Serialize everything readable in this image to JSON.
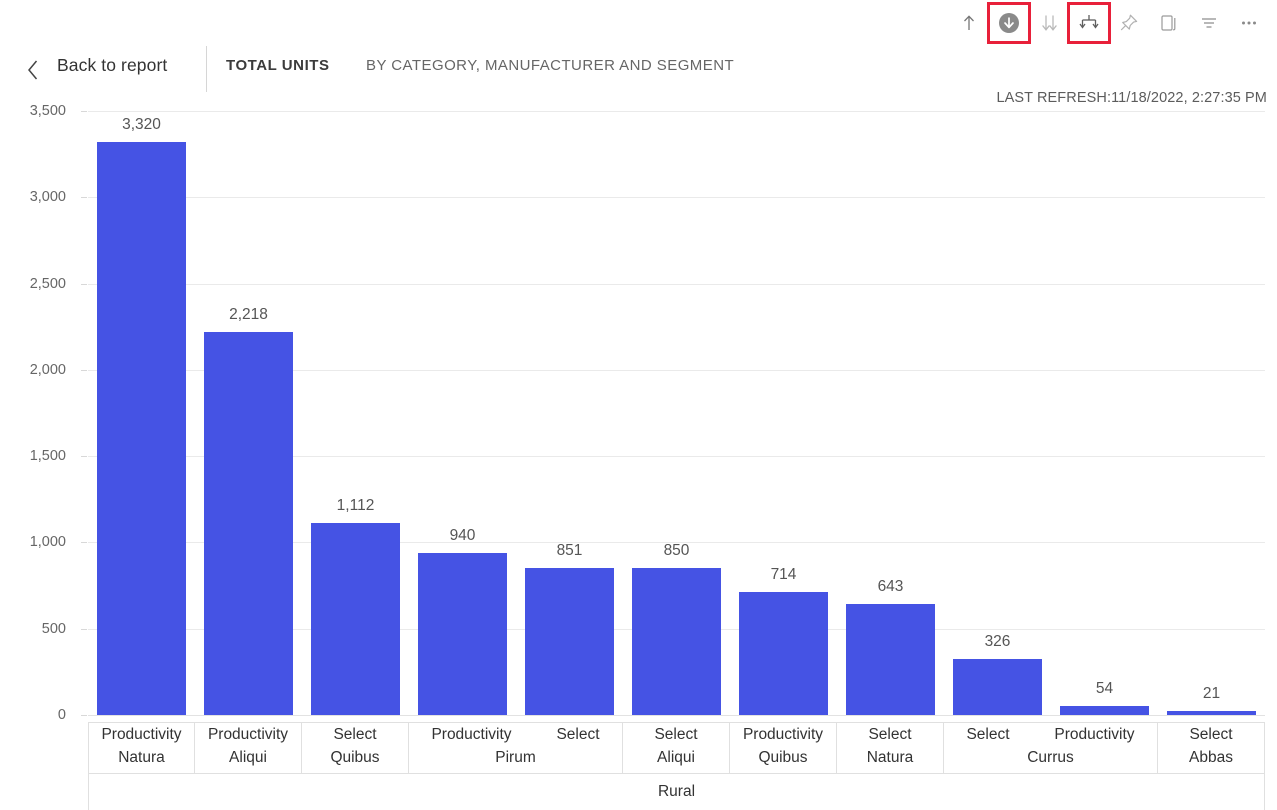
{
  "toolbar": {
    "icons": [
      {
        "name": "drill-up-icon",
        "label": "Drill up",
        "highlighted": false
      },
      {
        "name": "drill-down-toggle-icon",
        "label": "Click to turn on Drill Down",
        "highlighted": true
      },
      {
        "name": "expand-next-level-icon",
        "label": "Go to the next level in the hierarchy",
        "highlighted": false
      },
      {
        "name": "expand-all-down-icon",
        "label": "Expand all down one level in the hierarchy",
        "highlighted": true
      },
      {
        "name": "pin-visual-icon",
        "label": "Pin visual",
        "highlighted": false
      },
      {
        "name": "copy-visual-icon",
        "label": "Copy visual",
        "highlighted": false
      },
      {
        "name": "filter-icon",
        "label": "Filters",
        "highlighted": false
      },
      {
        "name": "more-options-icon",
        "label": "More options",
        "highlighted": false
      }
    ],
    "highlight_color": "#e8203a"
  },
  "header": {
    "back_label": "Back to report",
    "title_main": "TOTAL UNITS",
    "title_sub": "BY CATEGORY, MANUFACTURER AND SEGMENT",
    "last_refresh": "LAST REFRESH:11/18/2022, 2:27:35 PM"
  },
  "chart_data": {
    "type": "bar",
    "title": "TOTAL UNITS",
    "subtitle": "BY CATEGORY, MANUFACTURER AND SEGMENT",
    "xlabel": "",
    "ylabel": "",
    "ylim": [
      0,
      3500
    ],
    "yticks": [
      "0",
      "500",
      "1,000",
      "1,500",
      "2,000",
      "2,500",
      "3,000",
      "3,500"
    ],
    "ytick_values": [
      0,
      500,
      1000,
      1500,
      2000,
      2500,
      3000,
      3500
    ],
    "grid": true,
    "legend": "none",
    "bar_color": "#4553e4",
    "categories": [
      "Productivity Natura",
      "Productivity Aliqui",
      "Select Quibus",
      "Productivity Pirum",
      "Select Pirum",
      "Select Aliqui",
      "Productivity Quibus",
      "Select Natura",
      "Select Currus",
      "Productivity Currus",
      "Select Abbas"
    ],
    "values": [
      3320,
      2218,
      1112,
      940,
      851,
      850,
      714,
      643,
      326,
      54,
      21
    ],
    "value_labels": [
      "3,320",
      "2,218",
      "1,112",
      "940",
      "851",
      "850",
      "714",
      "643",
      "326",
      "54",
      "21"
    ],
    "segment_label": "Rural"
  },
  "axis_groups": [
    {
      "manufacturer": "Natura",
      "categories": [
        "Productivity"
      ],
      "span": 1
    },
    {
      "manufacturer": "Aliqui",
      "categories": [
        "Productivity"
      ],
      "span": 1
    },
    {
      "manufacturer": "Quibus",
      "categories": [
        "Select"
      ],
      "span": 1
    },
    {
      "manufacturer": "Pirum",
      "categories": [
        "Productivity",
        "Select"
      ],
      "span": 2
    },
    {
      "manufacturer": "Aliqui",
      "categories": [
        "Select"
      ],
      "span": 1
    },
    {
      "manufacturer": "Quibus",
      "categories": [
        "Productivity"
      ],
      "span": 1
    },
    {
      "manufacturer": "Natura",
      "categories": [
        "Select"
      ],
      "span": 1
    },
    {
      "manufacturer": "Currus",
      "categories": [
        "Select",
        "Productivity"
      ],
      "span": 2
    },
    {
      "manufacturer": "Abbas",
      "categories": [
        "Select"
      ],
      "span": 1
    }
  ]
}
